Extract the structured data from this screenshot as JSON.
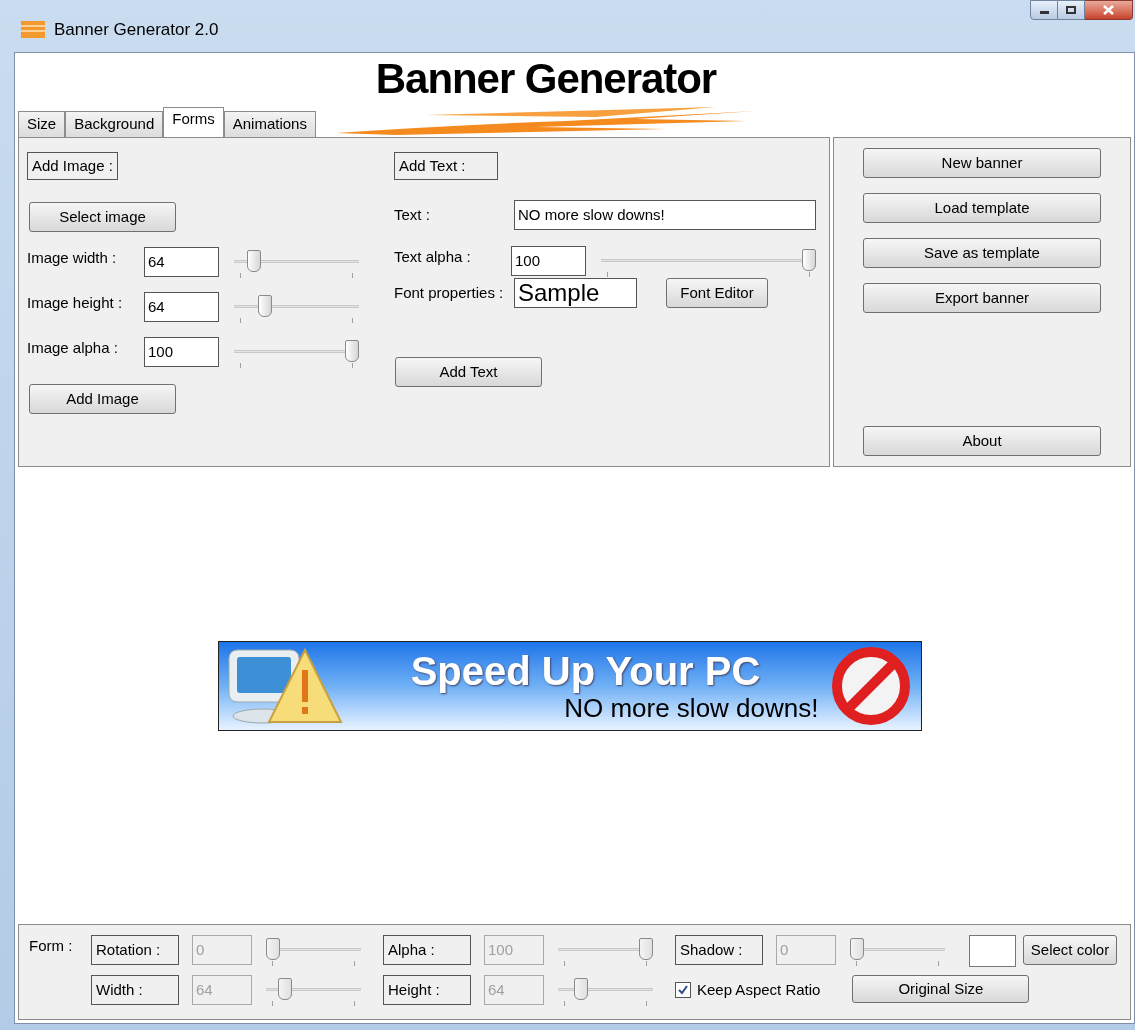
{
  "window": {
    "title": "Banner Generator 2.0"
  },
  "logo": {
    "title": "Banner Generator"
  },
  "tabs": [
    {
      "label": "Size",
      "selected": false
    },
    {
      "label": "Background",
      "selected": false
    },
    {
      "label": "Forms",
      "selected": true
    },
    {
      "label": "Animations",
      "selected": false
    }
  ],
  "add_image": {
    "heading": "Add Image :",
    "select_button": "Select image",
    "add_button": "Add Image",
    "fields": [
      {
        "label": "Image width :",
        "value": "64",
        "level": 0.12
      },
      {
        "label": "Image height :",
        "value": "64",
        "level": 0.22
      },
      {
        "label": "Image alpha :",
        "value": "100",
        "level": 1
      }
    ]
  },
  "add_text": {
    "heading": "Add Text :",
    "text_label": "Text :",
    "text_value": "NO more slow downs!",
    "alpha": {
      "label": "Text alpha :",
      "value": "100",
      "level": 1
    },
    "font_label": "Font properties :",
    "font_sample": "Sample",
    "font_button": "Font Editor",
    "add_button": "Add Text"
  },
  "actions": [
    "New banner",
    "Load template",
    "Save as template",
    "Export banner"
  ],
  "about_button": "About",
  "preview": {
    "headline": "Speed Up Your PC",
    "subline": "NO more slow downs!"
  },
  "form_bar": {
    "label": "Form :",
    "controls": [
      {
        "label": "Rotation :",
        "value": "0",
        "level": 0,
        "disabled": true
      },
      {
        "label": "Alpha :",
        "value": "100",
        "level": 1,
        "disabled": true
      },
      {
        "label": "Shadow :",
        "value": "0",
        "level": 0,
        "disabled": true
      },
      {
        "label": "Width :",
        "value": "64",
        "level": 0.15,
        "disabled": true
      },
      {
        "label": "Height :",
        "value": "64",
        "level": 0.2,
        "disabled": true
      }
    ],
    "keep_aspect": {
      "label": "Keep Aspect Ratio",
      "checked": true
    },
    "original_size": "Original Size",
    "select_color": "Select color"
  }
}
